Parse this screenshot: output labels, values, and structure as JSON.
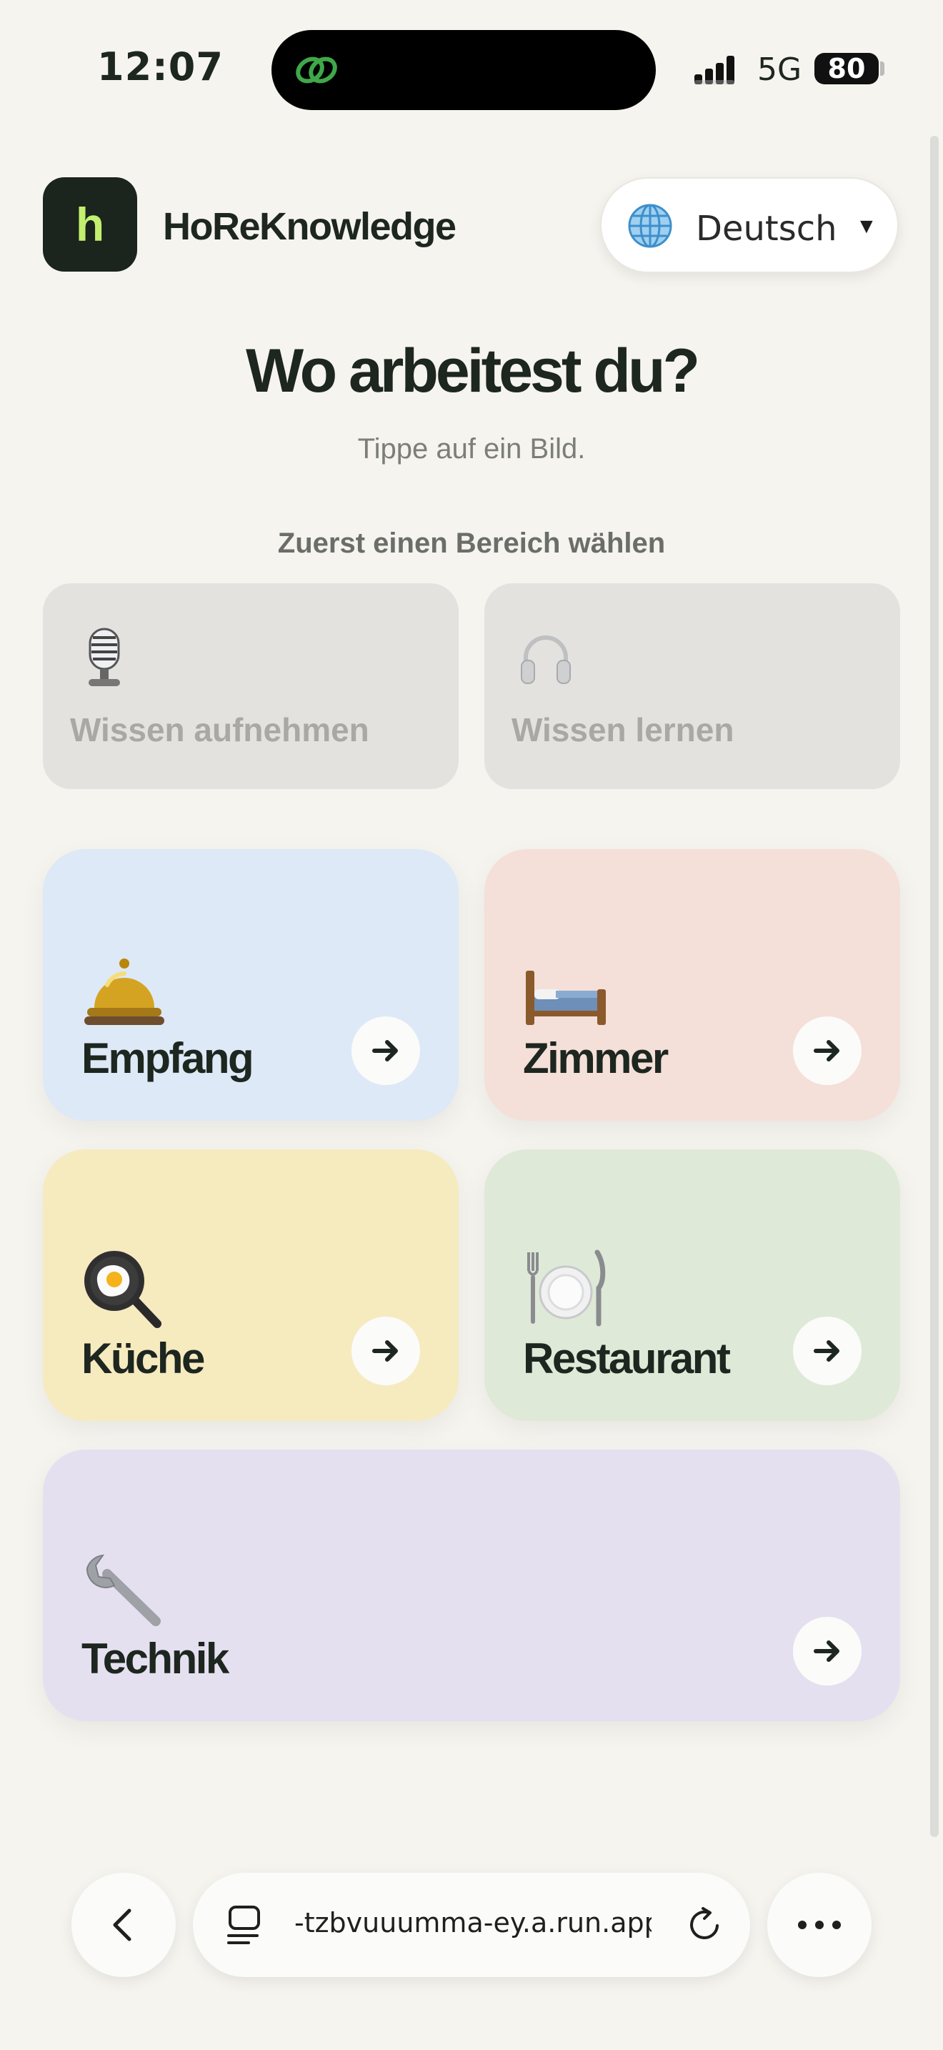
{
  "status_bar": {
    "time": "12:07",
    "network": "5G",
    "battery": "80"
  },
  "header": {
    "logo_letter": "h",
    "app_name": "HoReKnowledge",
    "language": "Deutsch"
  },
  "main": {
    "title": "Wo arbeitest du?",
    "subtitle": "Tippe auf ein Bild.",
    "section_hint": "Zuerst einen Bereich wählen"
  },
  "modes": [
    {
      "label": "Wissen aufnehmen",
      "icon": "microphone-icon"
    },
    {
      "label": "Wissen lernen",
      "icon": "headphones-icon"
    }
  ],
  "areas": [
    {
      "label": "Empfang",
      "icon": "bell-icon",
      "color": "#dde9f6"
    },
    {
      "label": "Zimmer",
      "icon": "bed-icon",
      "color": "#f5dfd9"
    },
    {
      "label": "Küche",
      "icon": "frying-pan-icon",
      "color": "#f6eabf"
    },
    {
      "label": "Restaurant",
      "icon": "plate-cutlery-icon",
      "color": "#dfe9d8"
    },
    {
      "label": "Technik",
      "icon": "wrench-icon",
      "color": "#e5e0f0"
    }
  ],
  "browser": {
    "url": "-tzbvuuumma-ey.a.run.app"
  }
}
